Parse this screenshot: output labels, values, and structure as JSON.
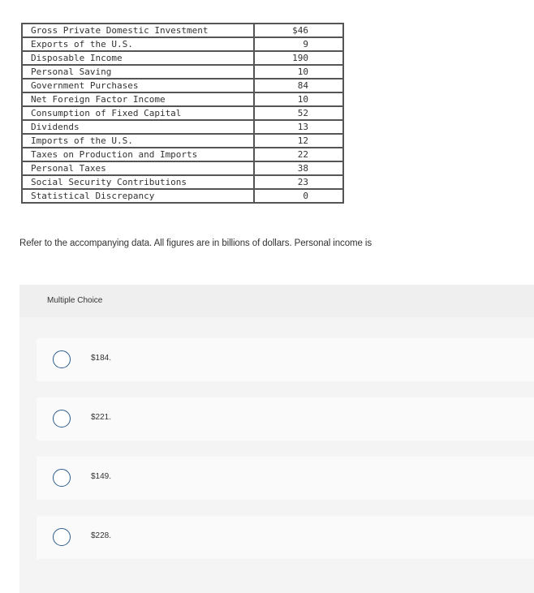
{
  "table": [
    {
      "label": "Gross Private Domestic Investment",
      "value": "$46"
    },
    {
      "label": "Exports of the U.S.",
      "value": "9"
    },
    {
      "label": "Disposable Income",
      "value": "190"
    },
    {
      "label": "Personal Saving",
      "value": "10"
    },
    {
      "label": "Government Purchases",
      "value": "84"
    },
    {
      "label": "Net Foreign Factor Income",
      "value": "10"
    },
    {
      "label": "Consumption of Fixed Capital",
      "value": "52"
    },
    {
      "label": "Dividends",
      "value": "13"
    },
    {
      "label": "Imports of the U.S.",
      "value": "12"
    },
    {
      "label": "Taxes on Production and Imports",
      "value": "22"
    },
    {
      "label": "Personal Taxes",
      "value": "38"
    },
    {
      "label": "Social Security Contributions",
      "value": "23"
    },
    {
      "label": "Statistical Discrepancy",
      "value": "0"
    }
  ],
  "question": "Refer to the accompanying data. All figures are in billions of dollars. Personal income is",
  "panel": {
    "title": "Multiple Choice",
    "options": [
      "$184.",
      "$221.",
      "$149.",
      "$228."
    ]
  },
  "colors": {
    "radio_border": "#2d5c8c",
    "panel_bg": "#f4f4f4"
  }
}
